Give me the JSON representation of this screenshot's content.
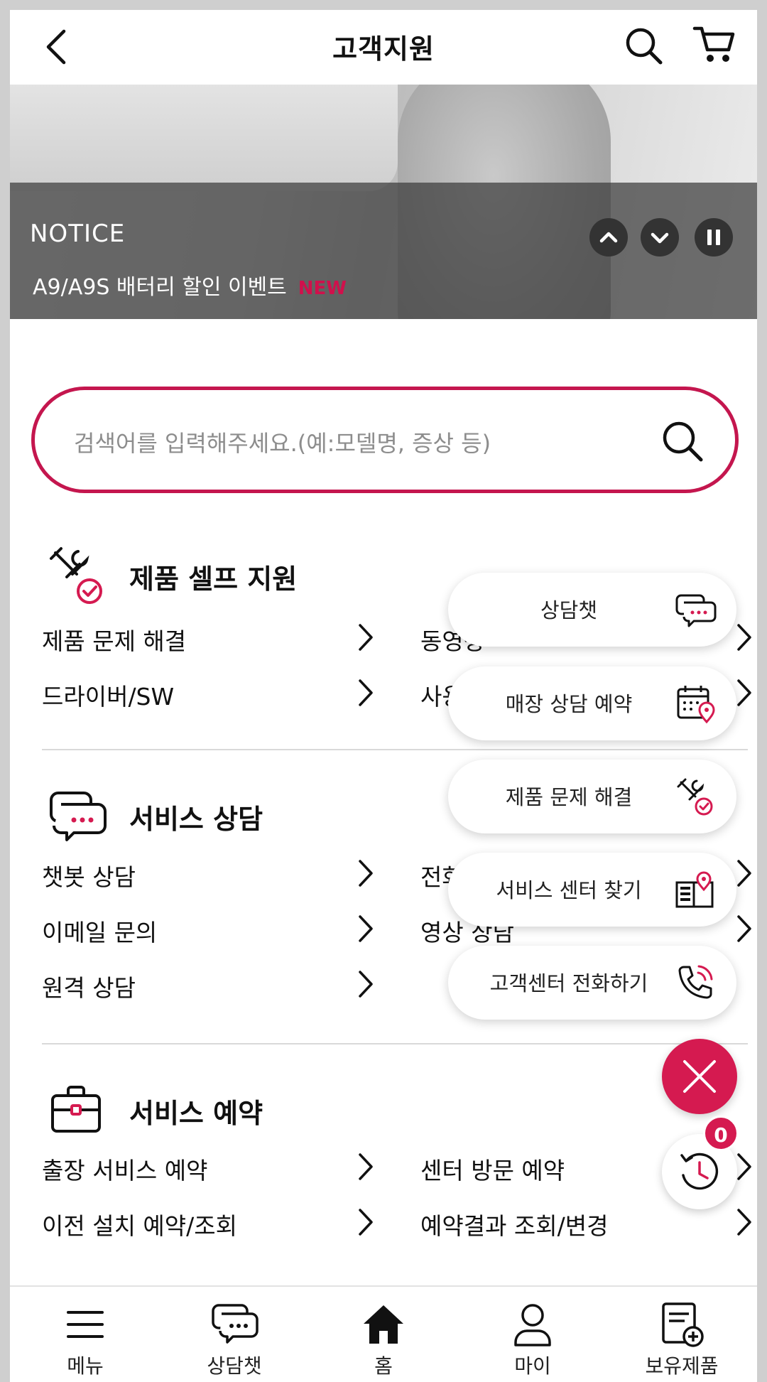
{
  "header": {
    "title": "고객지원"
  },
  "notice": {
    "label": "NOTICE",
    "text": "A9/A9S 배터리 할인 이벤트",
    "badge": "NEW"
  },
  "search": {
    "placeholder": "검색어를 입력해주세요.(예:모델명, 증상 등)"
  },
  "sections": [
    {
      "title": "제품 셀프 지원",
      "links": [
        "제품 문제 해결",
        "동영상",
        "드라이버/SW",
        "사용"
      ]
    },
    {
      "title": "서비스 상담",
      "links": [
        "챗봇 상담",
        "전화",
        "이메일 문의",
        "영상 상담",
        "원격 상담"
      ]
    },
    {
      "title": "서비스 예약",
      "links": [
        "출장 서비스 예약",
        "센터 방문 예약",
        "이전 설치 예약/조회",
        "예약결과 조회/변경"
      ]
    }
  ],
  "fab_menu": [
    {
      "label": "상담챗",
      "icon": "chat-icon"
    },
    {
      "label": "매장 상담 예약",
      "icon": "calendar-pin-icon"
    },
    {
      "label": "제품 문제 해결",
      "icon": "tools-check-icon"
    },
    {
      "label": "서비스 센터 찾기",
      "icon": "store-pin-icon"
    },
    {
      "label": "고객센터 전화하기",
      "icon": "phone-icon"
    }
  ],
  "history_count": "0",
  "bottom_nav": [
    {
      "label": "메뉴",
      "icon": "hamburger-icon"
    },
    {
      "label": "상담챗",
      "icon": "chat-icon"
    },
    {
      "label": "홈",
      "icon": "home-icon"
    },
    {
      "label": "마이",
      "icon": "user-icon"
    },
    {
      "label": "보유제품",
      "icon": "product-add-icon"
    }
  ],
  "colors": {
    "accent": "#d51a50",
    "text": "#111111",
    "divider": "#d9d9d9"
  }
}
